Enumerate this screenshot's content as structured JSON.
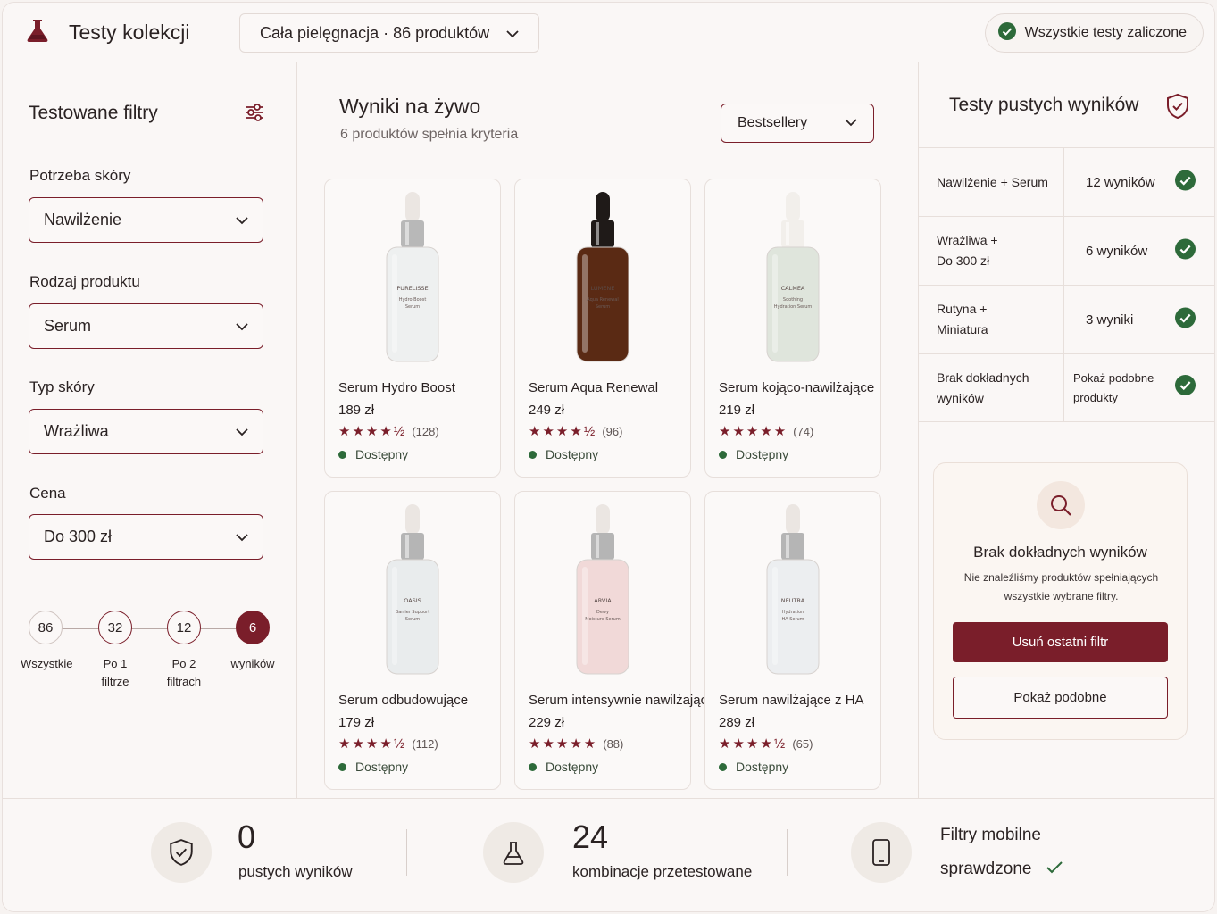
{
  "header": {
    "title": "Testy kolekcji",
    "collection": "Cała pielęgnacja · 86 produktów",
    "status": "Wszystkie testy zaliczone"
  },
  "sidebar": {
    "title": "Testowane filtry",
    "filters": [
      {
        "label": "Potrzeba skóry",
        "value": "Nawilżenie"
      },
      {
        "label": "Rodzaj produktu",
        "value": "Serum"
      },
      {
        "label": "Typ skóry",
        "value": "Wrażliwa"
      },
      {
        "label": "Cena",
        "value": "Do 300 zł"
      }
    ],
    "funnel": [
      {
        "count": "86",
        "label1": "Wszystkie",
        "label2": ""
      },
      {
        "count": "32",
        "label1": "Po 1",
        "label2": "filtrze"
      },
      {
        "count": "12",
        "label1": "Po 2",
        "label2": "filtrach"
      },
      {
        "count": "6",
        "label1": "wyników",
        "label2": ""
      }
    ]
  },
  "results": {
    "title": "Wyniki na żywo",
    "subtitle": "6 produktów spełnia kryteria",
    "sort": "Bestsellery",
    "products": [
      {
        "name": "Serum Hydro Boost",
        "price": "189 zł",
        "stars": "★★★★½",
        "reviews": "(128)",
        "availability": "Dostępny",
        "brand": "PURELISSE",
        "line1": "Hydro Boost",
        "line2": "Serum",
        "glass": "#eef0f0",
        "cap": "#ebe6e2",
        "collar": "#b8b8b8"
      },
      {
        "name": "Serum Aqua Renewal",
        "price": "249 zł",
        "stars": "★★★★½",
        "reviews": "(96)",
        "availability": "Dostępny",
        "brand": "LUMENE",
        "line1": "Aqua Renewal",
        "line2": "Serum",
        "glass": "#5a2a14",
        "cap": "#1f1a18",
        "collar": "#1f1a18"
      },
      {
        "name": "Serum kojąco-nawilżające",
        "price": "219 zł",
        "stars": "★★★★★",
        "reviews": "(74)",
        "availability": "Dostępny",
        "brand": "CALMEA",
        "line1": "Soothing",
        "line2": "Hydration Serum",
        "glass": "#dfe5dc",
        "cap": "#f2efeb",
        "collar": "#f2efeb"
      },
      {
        "name": "Serum odbudowujące",
        "price": "179 zł",
        "stars": "★★★★½",
        "reviews": "(112)",
        "availability": "Dostępny",
        "brand": "OASIS",
        "line1": "Barrier Support",
        "line2": "Serum",
        "glass": "#e9eced",
        "cap": "#ebe6e2",
        "collar": "#b5b5b5"
      },
      {
        "name": "Serum intensywnie nawilżające",
        "price": "229 zł",
        "stars": "★★★★★",
        "reviews": "(88)",
        "availability": "Dostępny",
        "brand": "ARVIA",
        "line1": "Dewy",
        "line2": "Moisture Serum",
        "glass": "#f1d9d8",
        "cap": "#ebe6e2",
        "collar": "#b5b5b5"
      },
      {
        "name": "Serum nawilżające z HA",
        "price": "289 zł",
        "stars": "★★★★½",
        "reviews": "(65)",
        "availability": "Dostępny",
        "brand": "NEUTRA",
        "line1": "Hydration",
        "line2": "HA Serum",
        "glass": "#eceef0",
        "cap": "#ebe6e2",
        "collar": "#b5b5b5"
      }
    ]
  },
  "tests": {
    "title": "Testy pustych wyników",
    "rows": [
      {
        "combo_line1": "Nawilżenie + Serum",
        "combo_line2": "",
        "result": "12 wyników"
      },
      {
        "combo_line1": "Wrażliwa +",
        "combo_line2": "Do 300 zł",
        "result": "6 wyników"
      },
      {
        "combo_line1": "Rutyna +",
        "combo_line2": "Miniatura",
        "result": "3 wyniki"
      },
      {
        "combo_line1": "Brak dokładnych",
        "combo_line2": "wyników",
        "result_line1": "Pokaż podobne",
        "result_line2": "produkty"
      }
    ],
    "empty_state": {
      "title": "Brak dokładnych wyników",
      "text_line1": "Nie znaleźliśmy produktów spełniających",
      "text_line2": "wszystkie wybrane filtry.",
      "primary": "Usuń ostatni filtr",
      "secondary": "Pokaż podobne"
    }
  },
  "stats": [
    {
      "number": "0",
      "label": "pustych wyników",
      "icon": "shield-check-icon"
    },
    {
      "number": "24",
      "label": "kombinacje przetestowane",
      "icon": "flask-icon"
    },
    {
      "line1": "Filtry mobilne",
      "line2": "sprawdzone",
      "icon": "phone-icon"
    }
  ],
  "colors": {
    "accent": "#7a1e2a",
    "success": "#2d6a3a",
    "background": "#faf7f6"
  }
}
